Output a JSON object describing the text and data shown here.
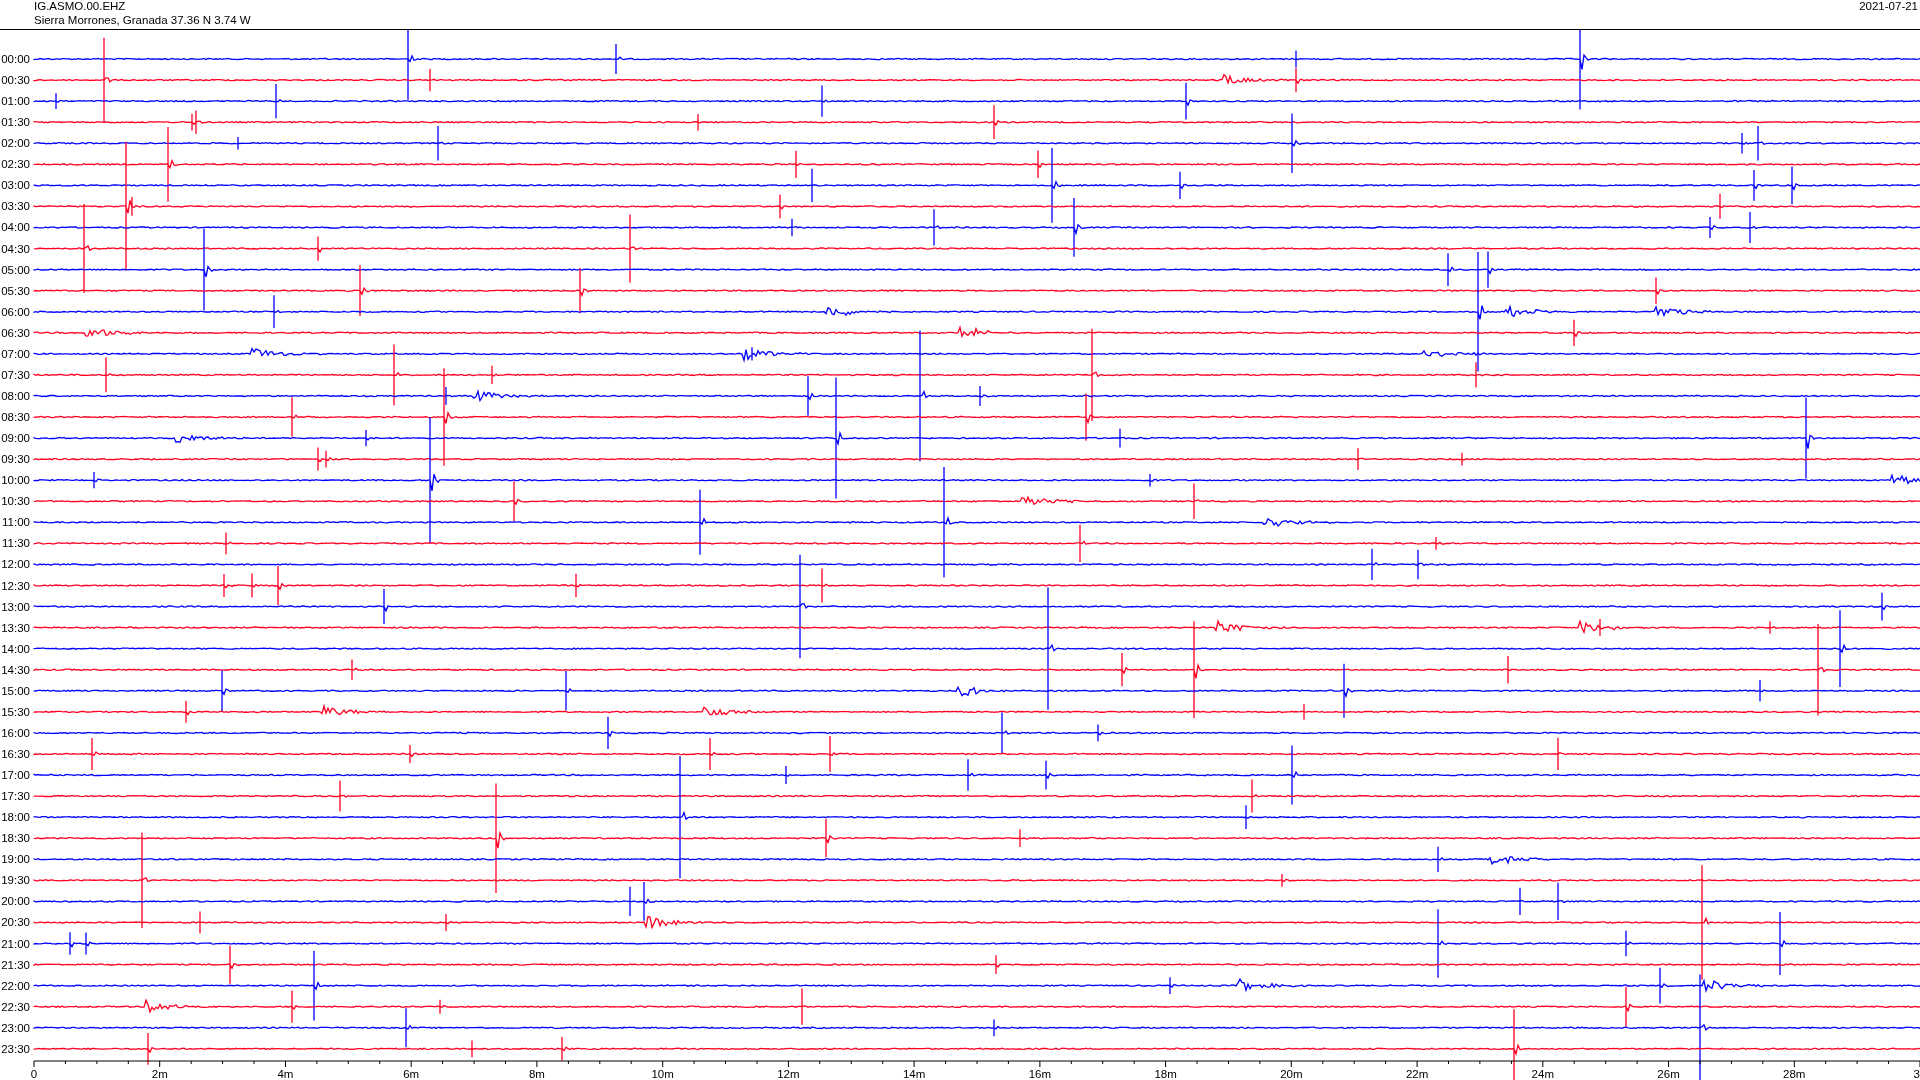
{
  "header": {
    "station": "IG.ASMO.00.EHZ",
    "location": "Sierra Morrones, Granada  37.36 N 3.74 W",
    "date": "2021-07-21"
  },
  "rows": [
    {
      "label": "00:00",
      "color": "#0000ff"
    },
    {
      "label": "00:30",
      "color": "#ff0022"
    },
    {
      "label": "01:00",
      "color": "#0000ff"
    },
    {
      "label": "01:30",
      "color": "#ff0022"
    },
    {
      "label": "02:00",
      "color": "#0000ff"
    },
    {
      "label": "02:30",
      "color": "#ff0022"
    },
    {
      "label": "03:00",
      "color": "#0000ff"
    },
    {
      "label": "03:30",
      "color": "#ff0022"
    },
    {
      "label": "04:00",
      "color": "#0000ff"
    },
    {
      "label": "04:30",
      "color": "#ff0022"
    },
    {
      "label": "05:00",
      "color": "#0000ff"
    },
    {
      "label": "05:30",
      "color": "#ff0022"
    },
    {
      "label": "06:00",
      "color": "#0000ff"
    },
    {
      "label": "06:30",
      "color": "#ff0022"
    },
    {
      "label": "07:00",
      "color": "#0000ff"
    },
    {
      "label": "07:30",
      "color": "#ff0022"
    },
    {
      "label": "08:00",
      "color": "#0000ff"
    },
    {
      "label": "08:30",
      "color": "#ff0022"
    },
    {
      "label": "09:00",
      "color": "#0000ff"
    },
    {
      "label": "09:30",
      "color": "#ff0022"
    },
    {
      "label": "10:00",
      "color": "#0000ff"
    },
    {
      "label": "10:30",
      "color": "#ff0022"
    },
    {
      "label": "11:00",
      "color": "#0000ff"
    },
    {
      "label": "11:30",
      "color": "#ff0022"
    },
    {
      "label": "12:00",
      "color": "#0000ff"
    },
    {
      "label": "12:30",
      "color": "#ff0022"
    },
    {
      "label": "13:00",
      "color": "#0000ff"
    },
    {
      "label": "13:30",
      "color": "#ff0022"
    },
    {
      "label": "14:00",
      "color": "#0000ff"
    },
    {
      "label": "14:30",
      "color": "#ff0022"
    },
    {
      "label": "15:00",
      "color": "#0000ff"
    },
    {
      "label": "15:30",
      "color": "#ff0022"
    },
    {
      "label": "16:00",
      "color": "#0000ff"
    },
    {
      "label": "16:30",
      "color": "#ff0022"
    },
    {
      "label": "17:00",
      "color": "#0000ff"
    },
    {
      "label": "17:30",
      "color": "#ff0022"
    },
    {
      "label": "18:00",
      "color": "#0000ff"
    },
    {
      "label": "18:30",
      "color": "#ff0022"
    },
    {
      "label": "19:00",
      "color": "#0000ff"
    },
    {
      "label": "19:30",
      "color": "#ff0022"
    },
    {
      "label": "20:00",
      "color": "#0000ff"
    },
    {
      "label": "20:30",
      "color": "#ff0022"
    },
    {
      "label": "21:00",
      "color": "#0000ff"
    },
    {
      "label": "21:30",
      "color": "#ff0022"
    },
    {
      "label": "22:00",
      "color": "#0000ff"
    },
    {
      "label": "22:30",
      "color": "#ff0022"
    },
    {
      "label": "23:00",
      "color": "#0000ff"
    },
    {
      "label": "23:30",
      "color": "#ff0022"
    }
  ],
  "x_axis": [
    "0",
    "2m",
    "4m",
    "6m",
    "8m",
    "10m",
    "12m",
    "14m",
    "16m",
    "18m",
    "20m",
    "22m",
    "24m",
    "26m",
    "28m",
    "3"
  ]
}
